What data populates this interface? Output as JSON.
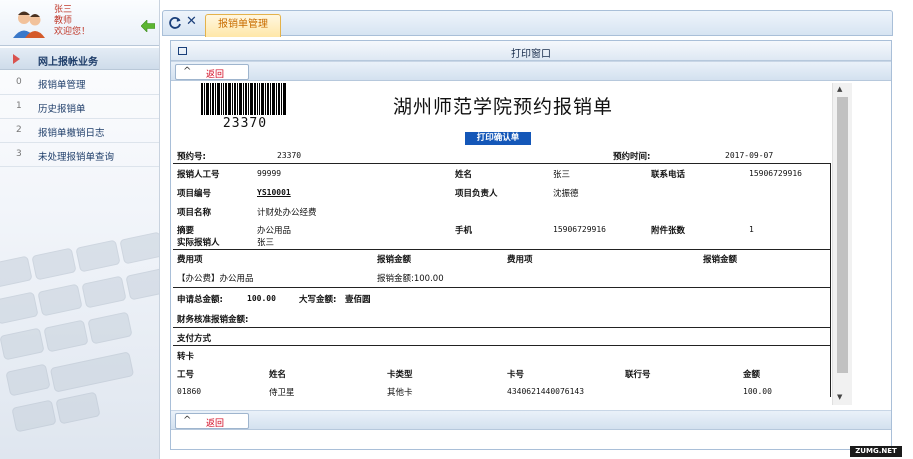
{
  "user": {
    "name": "张三",
    "role": "教师",
    "greeting": "欢迎您！"
  },
  "sidebar": {
    "section": "网上报帐业务",
    "items": [
      {
        "num": "0",
        "label": "报销单管理"
      },
      {
        "num": "1",
        "label": "历史报销单"
      },
      {
        "num": "2",
        "label": "报销单撤销日志"
      },
      {
        "num": "3",
        "label": "未处理报销单查询"
      }
    ]
  },
  "tabs": {
    "active": "报销单管理"
  },
  "print_window": {
    "title": "打印窗口",
    "back_label": "返回"
  },
  "doc": {
    "barcode_number": "23370",
    "title": "湖州师范学院预约报销单",
    "confirm": "打印确认单",
    "reservation_no_label": "预约号:",
    "reservation_no": "23370",
    "reservation_time_label": "预约时间:",
    "reservation_time": "2017-09-07",
    "staff_no_label": "报销人工号",
    "staff_no": "99999",
    "name_label": "姓名",
    "name": "张三",
    "phone_label": "联系电话",
    "phone": "15906729916",
    "project_no_label": "项目编号",
    "project_no": "YS10001",
    "project_lead_label": "项目负责人",
    "project_lead": "沈振德",
    "project_name_label": "项目名称",
    "project_name": "计财处办公经费",
    "summary_label": "摘要",
    "summary": "办公用品",
    "mobile_label": "手机",
    "mobile": "15906729916",
    "attach_label": "附件张数",
    "attach": "1",
    "actual_person_label": "实际报销人",
    "actual_person": "张三",
    "expense_item_label": "费用项",
    "expense_amount_label": "报销金额",
    "expense_item_label2": "费用项",
    "expense_amount_label2": "报销金额",
    "expense_item": "【办公费】办公用品",
    "expense_amount": "报销金额:100.00",
    "apply_total_label": "申请总金额:",
    "apply_total": "100.00",
    "capital_label": "大写金额:",
    "capital": "壹佰圆",
    "audit_label": "财务核准报销金额:",
    "payment_label": "支付方式",
    "transfer_label": "转卡",
    "card_headers": [
      "工号",
      "姓名",
      "卡类型",
      "卡号",
      "联行号",
      "金额"
    ],
    "card_row": [
      "01860",
      "侍卫星",
      "其他卡",
      "4340621440076143",
      "",
      "100.00"
    ]
  },
  "watermark": "ZUMG.NET"
}
